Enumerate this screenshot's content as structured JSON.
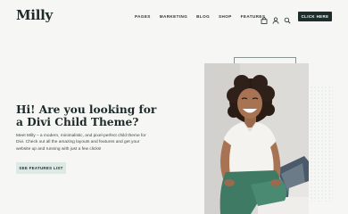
{
  "header": {
    "logo": "Milly",
    "nav": [
      "PAGES",
      "MARKETING",
      "BLOG",
      "SHOP",
      "FEATURES"
    ],
    "cta_label": "CLICK HERE",
    "icons": [
      "bag-icon",
      "user-icon",
      "search-icon"
    ]
  },
  "hero": {
    "title_lines": [
      "Hi! Are you looking for",
      "a Divi Child Theme?"
    ],
    "description_lines": [
      "Meet Milly – a modern, minimalistic, and pixel-perfect child theme for",
      "Divi. Check out all the amazing layouts and features and get your",
      "website up and running with just a few clicks!"
    ],
    "button_label": "SEE FEATURES LIST"
  },
  "colors": {
    "background": "#f6f6f4",
    "primary_dark": "#1d2d2c",
    "button_light": "#dde9e5",
    "dot_pattern": "#c9d9d4"
  }
}
